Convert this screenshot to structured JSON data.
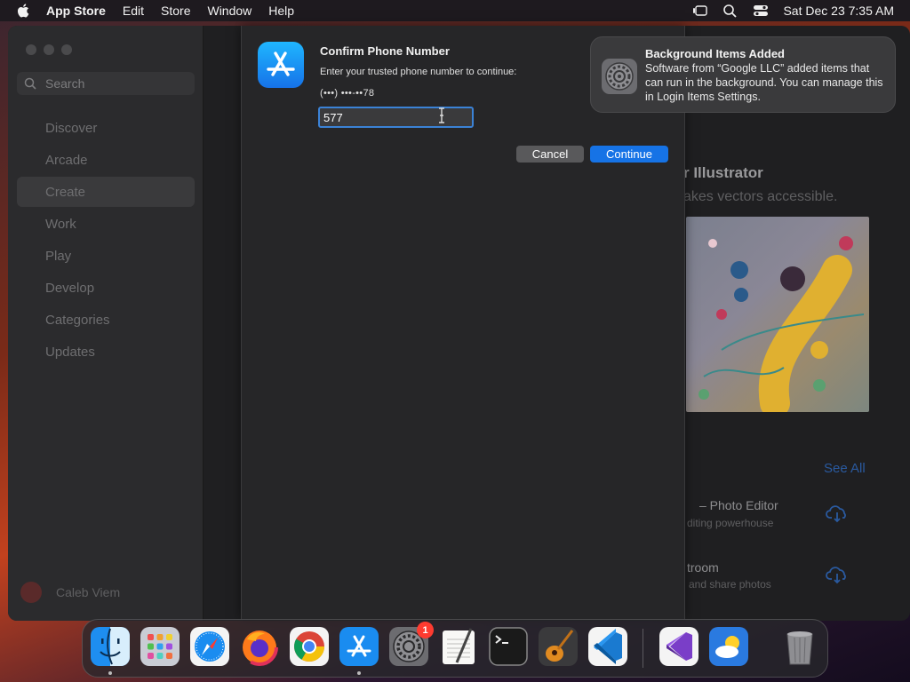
{
  "menubar": {
    "app_name": "App Store",
    "menus": [
      "Edit",
      "Store",
      "Window",
      "Help"
    ],
    "clock": "Sat Dec 23  7:35 AM"
  },
  "sidebar": {
    "search_placeholder": "Search",
    "items": [
      {
        "label": "Discover"
      },
      {
        "label": "Arcade"
      },
      {
        "label": "Create"
      },
      {
        "label": "Work"
      },
      {
        "label": "Play"
      },
      {
        "label": "Develop"
      },
      {
        "label": "Categories"
      },
      {
        "label": "Updates"
      }
    ],
    "active_item": "Create",
    "account_name": "Caleb Viem"
  },
  "main_peek": {
    "feature_title": "r Illustrator",
    "feature_subtitle": "akes vectors accessible.",
    "see_all": "See All",
    "apps": [
      {
        "title": "– Photo Editor",
        "subtitle": "diting powerhouse"
      },
      {
        "title": "troom",
        "subtitle": "and share photos"
      }
    ]
  },
  "dialog": {
    "title": "Confirm Phone Number",
    "message": "Enter your trusted phone number to continue:",
    "masked_phone": "(•••) •••-••78",
    "code_value": "577",
    "cancel_label": "Cancel",
    "continue_label": "Continue"
  },
  "notification": {
    "title": "Background Items Added",
    "body": "Software from “Google LLC” added items that can run in the background. You can manage this in Login Items Settings."
  },
  "dock": {
    "apps": [
      {
        "name": "finder",
        "running": true
      },
      {
        "name": "launchpad",
        "running": false
      },
      {
        "name": "safari",
        "running": false
      },
      {
        "name": "firefox",
        "running": false
      },
      {
        "name": "chrome",
        "running": false
      },
      {
        "name": "app-store",
        "running": true
      },
      {
        "name": "system-settings",
        "running": false,
        "badge": "1"
      },
      {
        "name": "textedit",
        "running": false
      },
      {
        "name": "terminal",
        "running": false
      },
      {
        "name": "garageband",
        "running": false
      },
      {
        "name": "vscode",
        "running": false
      },
      {
        "name": "visual-studio",
        "running": false
      },
      {
        "name": "weather",
        "running": false
      },
      {
        "name": "trash",
        "running": false
      }
    ]
  },
  "colors": {
    "accent": "#1673e6",
    "focus_ring": "#3b82d6",
    "badge": "#ff3b30"
  }
}
